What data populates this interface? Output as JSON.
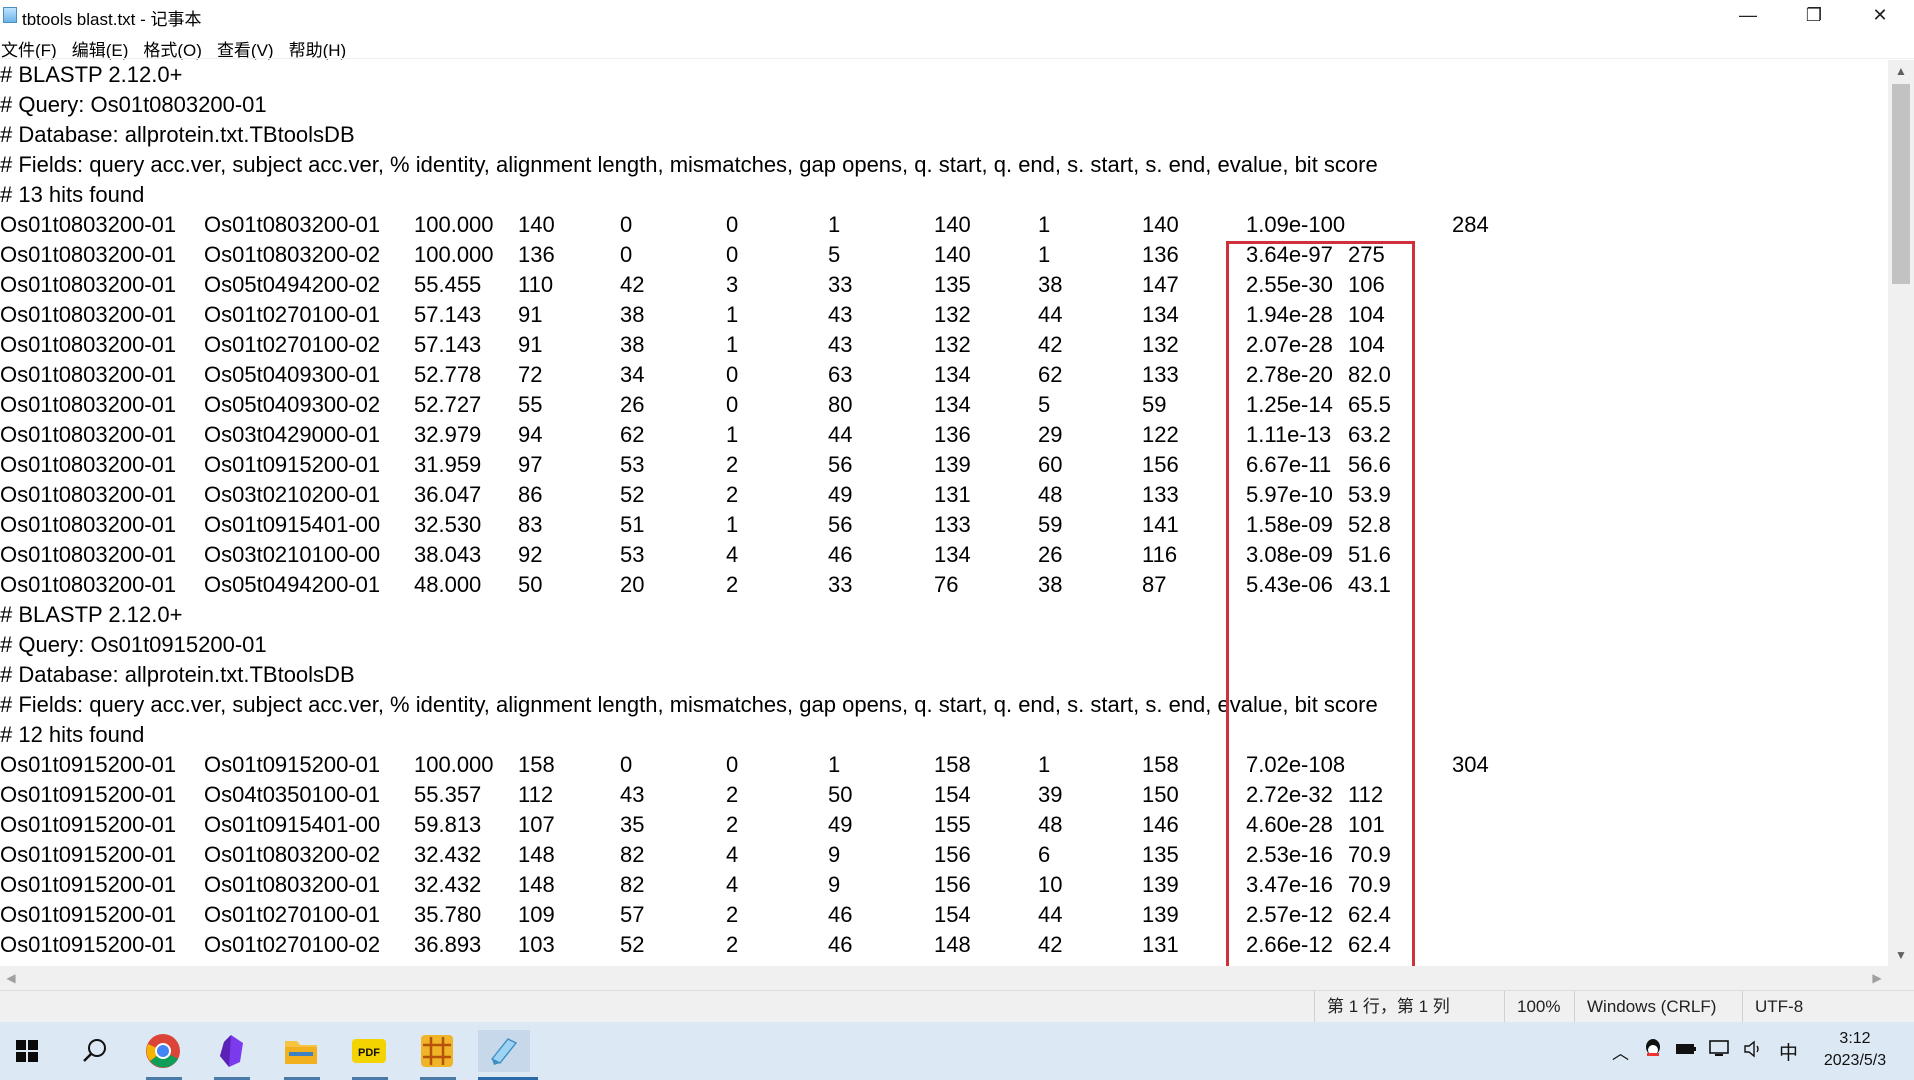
{
  "window": {
    "title": "tbtools blast.txt - 记事本",
    "minimize_glyph": "—",
    "maximize_glyph": "❐",
    "close_glyph": "✕"
  },
  "menu": [
    "文件(F)",
    "编辑(E)",
    "格式(O)",
    "查看(V)",
    "帮助(H)"
  ],
  "editor": {
    "lines": [
      {
        "type": "comment",
        "text": "# BLASTP 2.12.0+"
      },
      {
        "type": "comment",
        "text": "# Query: Os01t0803200-01"
      },
      {
        "type": "comment",
        "text": "# Database: allprotein.txt.TBtoolsDB"
      },
      {
        "type": "comment",
        "text": "# Fields: query acc.ver, subject acc.ver, % identity, alignment length, mismatches, gap opens, q. start, q. end, s. start, s. end, evalue, bit score"
      },
      {
        "type": "comment",
        "text": "# 13 hits found"
      },
      {
        "type": "row",
        "cols": [
          "Os01t0803200-01",
          "Os01t0803200-01",
          "100.000",
          "140",
          "0",
          "0",
          "1",
          "140",
          "1",
          "140",
          "1.09e-100",
          "284"
        ]
      },
      {
        "type": "row",
        "cols": [
          "Os01t0803200-01",
          "Os01t0803200-02",
          "100.000",
          "136",
          "0",
          "0",
          "5",
          "140",
          "1",
          "136",
          "3.64e-97",
          "275"
        ]
      },
      {
        "type": "row",
        "cols": [
          "Os01t0803200-01",
          "Os05t0494200-02",
          "55.455",
          "110",
          "42",
          "3",
          "33",
          "135",
          "38",
          "147",
          "2.55e-30",
          "106"
        ]
      },
      {
        "type": "row",
        "cols": [
          "Os01t0803200-01",
          "Os01t0270100-01",
          "57.143",
          "91",
          "38",
          "1",
          "43",
          "132",
          "44",
          "134",
          "1.94e-28",
          "104"
        ]
      },
      {
        "type": "row",
        "cols": [
          "Os01t0803200-01",
          "Os01t0270100-02",
          "57.143",
          "91",
          "38",
          "1",
          "43",
          "132",
          "42",
          "132",
          "2.07e-28",
          "104"
        ]
      },
      {
        "type": "row",
        "cols": [
          "Os01t0803200-01",
          "Os05t0409300-01",
          "52.778",
          "72",
          "34",
          "0",
          "63",
          "134",
          "62",
          "133",
          "2.78e-20",
          "82.0"
        ]
      },
      {
        "type": "row",
        "cols": [
          "Os01t0803200-01",
          "Os05t0409300-02",
          "52.727",
          "55",
          "26",
          "0",
          "80",
          "134",
          "5",
          "59",
          "1.25e-14",
          "65.5"
        ]
      },
      {
        "type": "row",
        "cols": [
          "Os01t0803200-01",
          "Os03t0429000-01",
          "32.979",
          "94",
          "62",
          "1",
          "44",
          "136",
          "29",
          "122",
          "1.11e-13",
          "63.2"
        ]
      },
      {
        "type": "row",
        "cols": [
          "Os01t0803200-01",
          "Os01t0915200-01",
          "31.959",
          "97",
          "53",
          "2",
          "56",
          "139",
          "60",
          "156",
          "6.67e-11",
          "56.6"
        ]
      },
      {
        "type": "row",
        "cols": [
          "Os01t0803200-01",
          "Os03t0210200-01",
          "36.047",
          "86",
          "52",
          "2",
          "49",
          "131",
          "48",
          "133",
          "5.97e-10",
          "53.9"
        ]
      },
      {
        "type": "row",
        "cols": [
          "Os01t0803200-01",
          "Os01t0915401-00",
          "32.530",
          "83",
          "51",
          "1",
          "56",
          "133",
          "59",
          "141",
          "1.58e-09",
          "52.8"
        ]
      },
      {
        "type": "row",
        "cols": [
          "Os01t0803200-01",
          "Os03t0210100-00",
          "38.043",
          "92",
          "53",
          "4",
          "46",
          "134",
          "26",
          "116",
          "3.08e-09",
          "51.6"
        ]
      },
      {
        "type": "row",
        "cols": [
          "Os01t0803200-01",
          "Os05t0494200-01",
          "48.000",
          "50",
          "20",
          "2",
          "33",
          "76",
          "38",
          "87",
          "5.43e-06",
          "43.1"
        ]
      },
      {
        "type": "comment",
        "text": "# BLASTP 2.12.0+"
      },
      {
        "type": "comment",
        "text": "# Query: Os01t0915200-01"
      },
      {
        "type": "comment",
        "text": "# Database: allprotein.txt.TBtoolsDB"
      },
      {
        "type": "comment",
        "text": "# Fields: query acc.ver, subject acc.ver, % identity, alignment length, mismatches, gap opens, q. start, q. end, s. start, s. end, evalue, bit score"
      },
      {
        "type": "comment",
        "text": "# 12 hits found"
      },
      {
        "type": "row",
        "cols": [
          "Os01t0915200-01",
          "Os01t0915200-01",
          "100.000",
          "158",
          "0",
          "0",
          "1",
          "158",
          "1",
          "158",
          "7.02e-108",
          "304"
        ]
      },
      {
        "type": "row",
        "cols": [
          "Os01t0915200-01",
          "Os04t0350100-01",
          "55.357",
          "112",
          "43",
          "2",
          "50",
          "154",
          "39",
          "150",
          "2.72e-32",
          "112"
        ]
      },
      {
        "type": "row",
        "cols": [
          "Os01t0915200-01",
          "Os01t0915401-00",
          "59.813",
          "107",
          "35",
          "2",
          "49",
          "155",
          "48",
          "146",
          "4.60e-28",
          "101"
        ]
      },
      {
        "type": "row",
        "cols": [
          "Os01t0915200-01",
          "Os01t0803200-02",
          "32.432",
          "148",
          "82",
          "4",
          "9",
          "156",
          "6",
          "135",
          "2.53e-16",
          "70.9"
        ]
      },
      {
        "type": "row",
        "cols": [
          "Os01t0915200-01",
          "Os01t0803200-01",
          "32.432",
          "148",
          "82",
          "4",
          "9",
          "156",
          "10",
          "139",
          "3.47e-16",
          "70.9"
        ]
      },
      {
        "type": "row",
        "cols": [
          "Os01t0915200-01",
          "Os01t0270100-01",
          "35.780",
          "109",
          "57",
          "2",
          "46",
          "154",
          "44",
          "139",
          "2.57e-12",
          "62.4"
        ]
      },
      {
        "type": "row",
        "cols": [
          "Os01t0915200-01",
          "Os01t0270100-02",
          "36.893",
          "103",
          "52",
          "2",
          "46",
          "148",
          "42",
          "131",
          "2.66e-12",
          "62.4"
        ]
      }
    ]
  },
  "statusbar": {
    "position": "第 1 行，第 1 列",
    "zoom": "100%",
    "line_ending": "Windows (CRLF)",
    "encoding": "UTF-8"
  },
  "taskbar": {
    "apps": [
      "windows-start-icon",
      "search-icon",
      "chrome-icon",
      "obsidian-icon",
      "file-explorer-icon",
      "pdf-reader-icon",
      "grid-app-icon",
      "notepad-icon"
    ],
    "ime": "中",
    "time": "3:12",
    "date": "2023/5/3"
  }
}
